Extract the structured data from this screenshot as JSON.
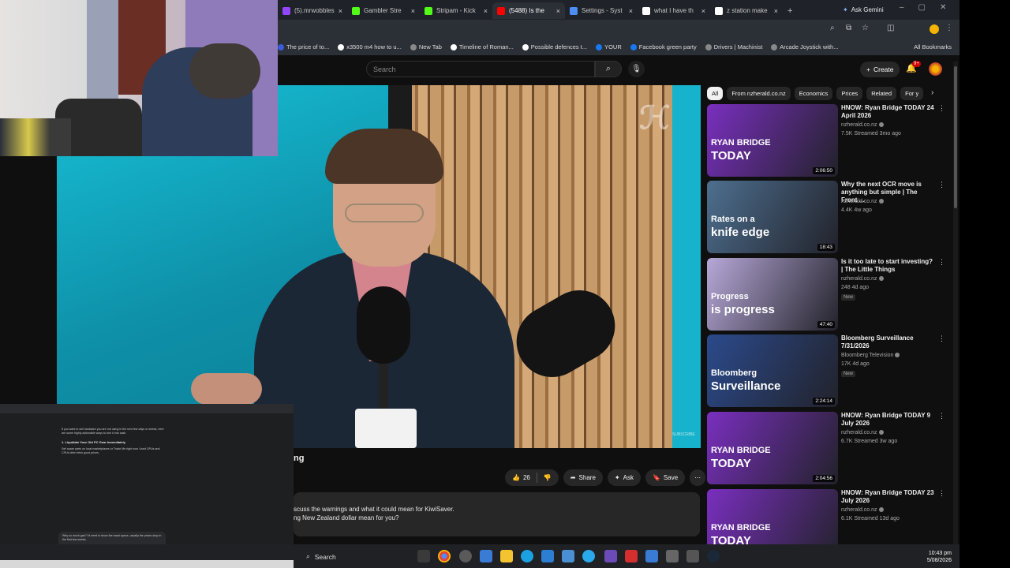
{
  "browser": {
    "tabs": [
      {
        "label": "(5).mrwobbles",
        "color": "#9146ff",
        "active": false
      },
      {
        "label": "Gambler Stre",
        "color": "#53fc18",
        "active": false
      },
      {
        "label": "Stripam - Kick",
        "color": "#53fc18",
        "active": false
      },
      {
        "label": "(5488) Is the",
        "color": "#ff0000",
        "active": true
      },
      {
        "label": "Settings - Syst",
        "color": "#4c8df6",
        "active": false
      },
      {
        "label": "what I have th",
        "color": "#ffffff",
        "active": false
      },
      {
        "label": "z station make",
        "color": "#ffffff",
        "active": false
      }
    ],
    "gemini_label": "Ask Gemini",
    "bookmarks": [
      {
        "label": "The price of to...",
        "color": "#3b5bdb"
      },
      {
        "label": "x3500 m4 how to u...",
        "color": "#ffffff"
      },
      {
        "label": "New Tab",
        "color": "#888888"
      },
      {
        "label": "Timeline of Roman...",
        "color": "#ffffff"
      },
      {
        "label": "Possible defences t...",
        "color": "#ffffff"
      },
      {
        "label": "YOUR",
        "color": "#1877f2"
      },
      {
        "label": "Facebook green party",
        "color": "#1877f2"
      },
      {
        "label": "Drivers | Machinist",
        "color": "#888888"
      },
      {
        "label": "Arcade Joystick with...",
        "color": "#888888"
      }
    ],
    "all_bookmarks": "All Bookmarks"
  },
  "youtube": {
    "search_placeholder": "Search",
    "create_label": "Create",
    "notif_count": "9+",
    "title_fragment": "ng",
    "likes": "26",
    "share": "Share",
    "ask": "Ask",
    "save": "Save",
    "desc_line1": "scuss the warnings and what it could mean for KiwiSaver.",
    "desc_line2": "ng New Zealand dollar mean for you?",
    "watermark": "SUBSCRIBE",
    "chips": [
      "All",
      "From nzherald.co.nz",
      "Economics",
      "Prices",
      "Related",
      "For y"
    ],
    "recommendations": [
      {
        "title": "HNOW: Ryan Bridge TODAY 24 April 2026",
        "channel": "nzherald.co.nz",
        "meta": "7.5K   Streamed 3mo ago",
        "duration": "2:06:50",
        "thumb_l1": "RYAN BRIDGE",
        "thumb_l2": "TODAY",
        "bg": "#7a2fbf",
        "badge": ""
      },
      {
        "title": "Why the next OCR move is anything but simple | The Front ...",
        "channel": "nzherald.co.nz",
        "meta": "4.4K   4w ago",
        "duration": "18:43",
        "thumb_l1": "Rates on a",
        "thumb_l2": "knife edge",
        "bg": "#4d6f8f",
        "badge": ""
      },
      {
        "title": "Is it too late to start investing? | The Little Things",
        "channel": "nzherald.co.nz",
        "meta": "248   4d ago",
        "duration": "47:40",
        "thumb_l1": "Progress",
        "thumb_l2": "is progress",
        "bg": "#b7a8d8",
        "badge": "New"
      },
      {
        "title": "Bloomberg Surveillance 7/31/2026",
        "channel": "Bloomberg Television",
        "meta": "17K   4d ago",
        "duration": "2:24:14",
        "thumb_l1": "Bloomberg",
        "thumb_l2": "Surveillance",
        "bg": "#2b4a8c",
        "badge": "New"
      },
      {
        "title": "HNOW: Ryan Bridge TODAY 9 July 2026",
        "channel": "nzherald.co.nz",
        "meta": "6.7K   Streamed 3w ago",
        "duration": "2:04:56",
        "thumb_l1": "RYAN BRIDGE",
        "thumb_l2": "TODAY",
        "bg": "#7a2fbf",
        "badge": ""
      },
      {
        "title": "HNOW: Ryan Bridge TODAY 23 July 2026",
        "channel": "nzherald.co.nz",
        "meta": "6.1K   Streamed 13d ago",
        "duration": "",
        "thumb_l1": "RYAN BRIDGE",
        "thumb_l2": "TODAY",
        "bg": "#7a2fbf",
        "badge": ""
      }
    ]
  },
  "chat": {
    "heading": "1. Liquidate Your Old PC Gear Immediately",
    "p1": "If you want to sell hardware you are not using in the next few days or weeks, here are some highly actionable ways to turn it into cash.",
    "p2": "Sell spare parts on local marketplaces or Trade Me right now. Used GPUs and CPUs often fetch good prices.",
    "input": "Why so much gas? I'd need to know the exact specs, usually the prices drop in the first few weeks."
  },
  "taskbar": {
    "search": "Search",
    "time": "10:43 pm",
    "date": "5/08/2026"
  }
}
